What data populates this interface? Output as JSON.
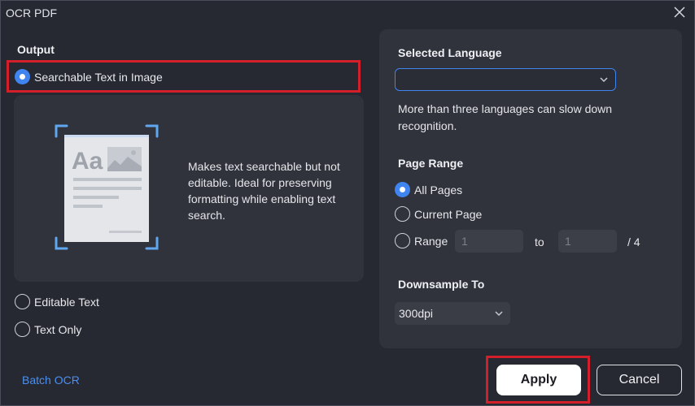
{
  "window": {
    "title": "OCR PDF",
    "close_icon": "close-icon"
  },
  "output": {
    "label": "Output",
    "options": [
      {
        "label": "Searchable Text in Image",
        "checked": true
      },
      {
        "label": "Editable Text",
        "checked": false
      },
      {
        "label": "Text Only",
        "checked": false
      }
    ],
    "preview": {
      "sample_text": "Aa",
      "description": "Makes text searchable but not editable. Ideal for preserving formatting while enabling text search."
    }
  },
  "language": {
    "label": "Selected Language",
    "selected_value": "",
    "note": "More than three languages can slow down recognition."
  },
  "page_range": {
    "label": "Page Range",
    "options": [
      {
        "label": "All Pages",
        "checked": true
      },
      {
        "label": "Current Page",
        "checked": false
      },
      {
        "label": "Range",
        "checked": false
      }
    ],
    "from_value": "1",
    "to_label": "to",
    "to_value": "1",
    "total": "/ 4"
  },
  "downsample": {
    "label": "Downsample To",
    "value": "300dpi"
  },
  "footer": {
    "batch_link": "Batch OCR",
    "apply_label": "Apply",
    "cancel_label": "Cancel"
  },
  "colors": {
    "accent": "#3f84ef",
    "highlight": "#d21f2a",
    "background": "#262832",
    "panel": "#30323c"
  }
}
